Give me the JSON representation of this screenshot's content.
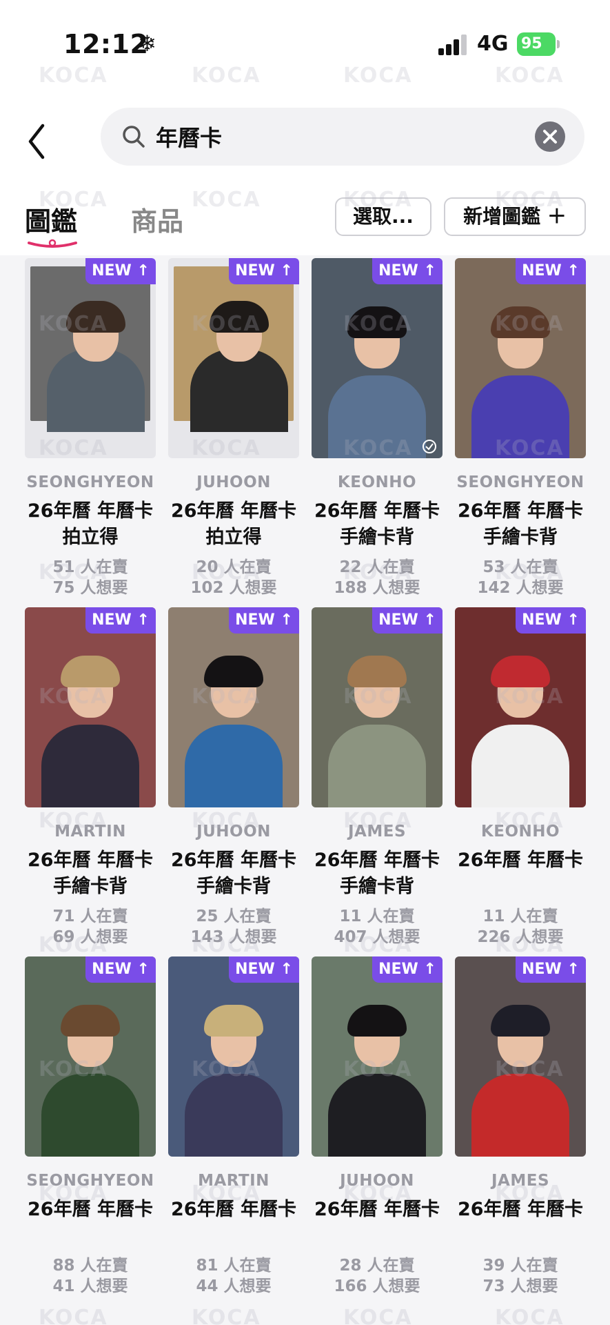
{
  "status_bar": {
    "time": "12:12",
    "network": "4G",
    "battery": "95"
  },
  "search": {
    "value": "年曆卡"
  },
  "tabs": [
    {
      "label": "圖鑑",
      "active": true
    },
    {
      "label": "商品",
      "active": false
    }
  ],
  "buttons": {
    "select": "選取...",
    "add": "新增圖鑑 ＋"
  },
  "badge_label": "NEW ↑",
  "watermark": "KOCA",
  "cards": [
    {
      "name": "SEONGHYEON",
      "title": "26年曆 年曆卡 拍立得",
      "selling": "51 人在賣",
      "wanting": "75 人想要",
      "style": "polaroid",
      "bg": "#6b6b6b",
      "hair": "#3a2b22",
      "top": "#55606a"
    },
    {
      "name": "JUHOON",
      "title": "26年曆 年曆卡 拍立得",
      "selling": "20 人在賣",
      "wanting": "102 人想要",
      "style": "polaroid",
      "bg": "#b89a6a",
      "hair": "#1e1a18",
      "top": "#2a2a2a"
    },
    {
      "name": "KEONHO",
      "title": "26年曆 年曆卡 手繪卡背",
      "selling": "22 人在賣",
      "wanting": "188 人想要",
      "style": "photo",
      "bg": "#4f5a66",
      "hair": "#141214",
      "top": "#5a7292",
      "checked": true
    },
    {
      "name": "SEONGHYEON",
      "title": "26年曆 年曆卡 手繪卡背",
      "selling": "53 人在賣",
      "wanting": "142 人想要",
      "style": "photo",
      "bg": "#7c6a5a",
      "hair": "#5a3a2a",
      "top": "#4a3fb0"
    },
    {
      "name": "MARTIN",
      "title": "26年曆 年曆卡 手繪卡背",
      "selling": "71 人在賣",
      "wanting": "69 人想要",
      "style": "photo",
      "bg": "#8a4a4a",
      "hair": "#b99a6a",
      "top": "#2e2a3a"
    },
    {
      "name": "JUHOON",
      "title": "26年曆 年曆卡 手繪卡背",
      "selling": "25 人在賣",
      "wanting": "143 人想要",
      "style": "photo",
      "bg": "#8e7f70",
      "hair": "#141214",
      "top": "#2f6aa8"
    },
    {
      "name": "JAMES",
      "title": "26年曆 年曆卡 手繪卡背",
      "selling": "11 人在賣",
      "wanting": "407 人想要",
      "style": "photo",
      "bg": "#6a6c5e",
      "hair": "#a07850",
      "top": "#8c9480"
    },
    {
      "name": "KEONHO",
      "title": "26年曆 年曆卡",
      "selling": "11 人在賣",
      "wanting": "226 人想要",
      "style": "photo",
      "bg": "#6e2e2e",
      "hair": "#c02a30",
      "top": "#f0f0f0"
    },
    {
      "name": "SEONGHYEON",
      "title": "26年曆 年曆卡",
      "selling": "88 人在賣",
      "wanting": "41 人想要",
      "style": "photo",
      "bg": "#5a6a5a",
      "hair": "#6a4a30",
      "top": "#2e4a2e"
    },
    {
      "name": "MARTIN",
      "title": "26年曆 年曆卡",
      "selling": "81 人在賣",
      "wanting": "44 人想要",
      "style": "photo",
      "bg": "#4a5a7a",
      "hair": "#c8b07a",
      "top": "#3a3a5a"
    },
    {
      "name": "JUHOON",
      "title": "26年曆 年曆卡",
      "selling": "28 人在賣",
      "wanting": "166 人想要",
      "style": "photo",
      "bg": "#6a7a6a",
      "hair": "#141214",
      "top": "#1e1e22"
    },
    {
      "name": "JAMES",
      "title": "26年曆 年曆卡",
      "selling": "39 人在賣",
      "wanting": "73 人想要",
      "style": "photo",
      "bg": "#5a5050",
      "hair": "#1e1e28",
      "top": "#c42a2a"
    }
  ]
}
